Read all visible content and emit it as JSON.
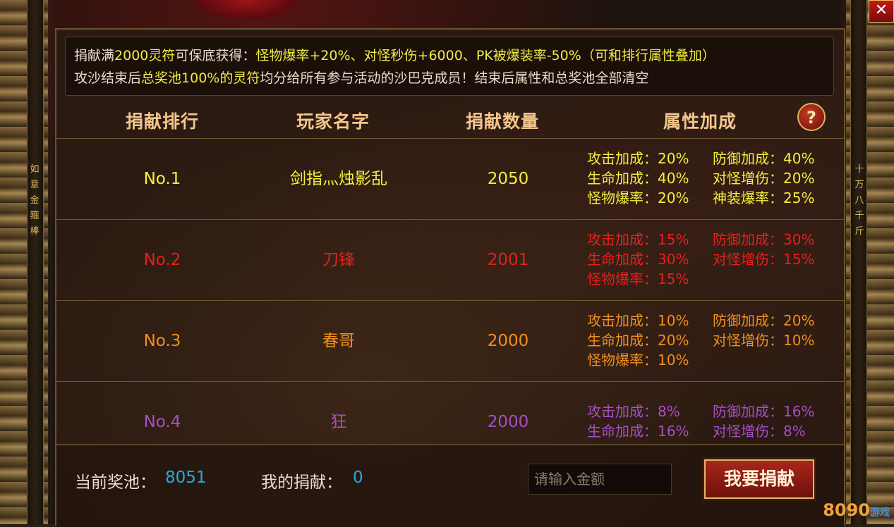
{
  "notice": {
    "line1_a": "捐献满",
    "line1_b": "2000灵符",
    "line1_c": "可保底获得：",
    "line1_d": "怪物爆率+20%、对怪秒伤+6000、PK被爆装率-50%",
    "line1_e": "（可和排行属性叠加）",
    "line2_a": "攻沙结束后",
    "line2_b": "总奖池100%的灵符",
    "line2_c": "均分给所有参与活动的沙巴克成员！结束后属性和总奖池全部清空"
  },
  "headers": {
    "rank": "捐献排行",
    "name": "玩家名字",
    "amount": "捐献数量",
    "attrs": "属性加成",
    "help": "?"
  },
  "rows": [
    {
      "rank": "No.1",
      "name": "剑指灬烛影乱",
      "amount": "2050",
      "color": "#f3ee3c",
      "attrs": [
        "攻击加成：20%",
        "防御加成：40%",
        "生命加成：40%",
        "对怪增伤：20%",
        "怪物爆率：20%",
        "神装爆率：25%"
      ]
    },
    {
      "rank": "No.2",
      "name": "刀锋",
      "amount": "2001",
      "color": "#e3211d",
      "attrs": [
        "攻击加成：15%",
        "防御加成：30%",
        "生命加成：30%",
        "对怪增伤：15%",
        "怪物爆率：15%"
      ]
    },
    {
      "rank": "No.3",
      "name": "春哥",
      "amount": "2000",
      "color": "#ef8f1c",
      "attrs": [
        "攻击加成：10%",
        "防御加成：20%",
        "生命加成：20%",
        "对怪增伤：10%",
        "怪物爆率：10%"
      ]
    },
    {
      "rank": "No.4",
      "name": "狂",
      "amount": "2000",
      "color": "#a54fc3",
      "attrs": [
        "攻击加成：8%",
        "防御加成：16%",
        "生命加成：16%",
        "对怪增伤：8%"
      ]
    }
  ],
  "footer": {
    "pool_label": "当前奖池：",
    "pool_value": "8051",
    "my_label": "我的捐献：",
    "my_value": "0",
    "input_placeholder": "请输入金额",
    "donate_button": "我要捐献"
  },
  "frame": {
    "left_vertical": "如 意 金 箍 棒",
    "right_vertical": "十 万 八 千 斤",
    "close": "✕"
  },
  "watermark": {
    "main": "8090",
    "sub": "游戏"
  }
}
